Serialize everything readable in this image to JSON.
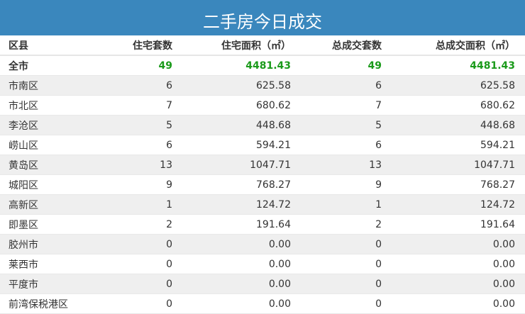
{
  "title": "二手房今日成交",
  "headers": [
    "区县",
    "住宅套数",
    "住宅面积（㎡）",
    "总成交套数",
    "总成交面积（㎡）"
  ],
  "colors": {
    "title_bg": "#3a87bd",
    "total_text": "#1a9a1a"
  },
  "rows": [
    [
      "全市",
      "49",
      "4481.43",
      "49",
      "4481.43"
    ],
    [
      "市南区",
      "6",
      "625.58",
      "6",
      "625.58"
    ],
    [
      "市北区",
      "7",
      "680.62",
      "7",
      "680.62"
    ],
    [
      "李沧区",
      "5",
      "448.68",
      "5",
      "448.68"
    ],
    [
      "崂山区",
      "6",
      "594.21",
      "6",
      "594.21"
    ],
    [
      "黄岛区",
      "13",
      "1047.71",
      "13",
      "1047.71"
    ],
    [
      "城阳区",
      "9",
      "768.27",
      "9",
      "768.27"
    ],
    [
      "高新区",
      "1",
      "124.72",
      "1",
      "124.72"
    ],
    [
      "即墨区",
      "2",
      "191.64",
      "2",
      "191.64"
    ],
    [
      "胶州市",
      "0",
      "0.00",
      "0",
      "0.00"
    ],
    [
      "莱西市",
      "0",
      "0.00",
      "0",
      "0.00"
    ],
    [
      "平度市",
      "0",
      "0.00",
      "0",
      "0.00"
    ],
    [
      "前湾保税港区",
      "0",
      "0.00",
      "0",
      "0.00"
    ]
  ]
}
